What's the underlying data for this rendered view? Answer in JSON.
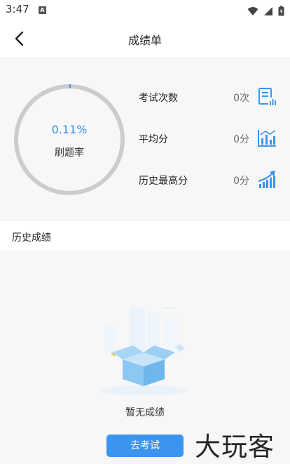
{
  "status_bar": {
    "time": "3:47",
    "notification_badge": "A"
  },
  "nav": {
    "title": "成绩单"
  },
  "progress": {
    "value_text": "0.11%",
    "label": "刷题率",
    "fraction": 0.0011
  },
  "stats": [
    {
      "label": "考试次数",
      "value": "0次",
      "icon": "exam-report-icon"
    },
    {
      "label": "平均分",
      "value": "0分",
      "icon": "bar-chart-icon"
    },
    {
      "label": "历史最高分",
      "value": "0分",
      "icon": "trend-up-icon"
    }
  ],
  "history": {
    "title": "历史成绩",
    "empty_text": "暂无成绩",
    "button_label": "去考试"
  },
  "watermark": "大玩客",
  "colors": {
    "accent": "#3b95ee",
    "ring_track": "#cccccc",
    "panel_bg": "#f7f7f7"
  }
}
